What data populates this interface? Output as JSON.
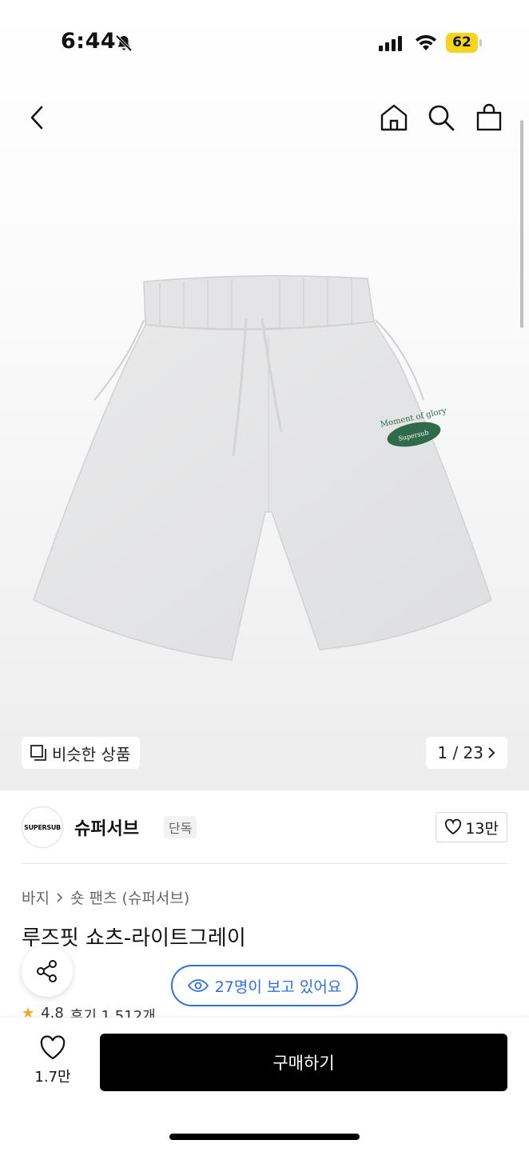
{
  "status_bar": {
    "time": "6:44",
    "battery": "62",
    "icons": [
      "bell-slash-icon",
      "signal-icon",
      "wifi-icon",
      "battery-icon"
    ]
  },
  "top_nav": {
    "icons": [
      "back-arrow-icon",
      "home-icon",
      "search-icon",
      "shopping-bag-icon"
    ]
  },
  "gallery": {
    "similar_label": "비슷한 상품",
    "counter": "1 / 23",
    "photo_text": [
      "Moment of glory",
      "Supersub"
    ]
  },
  "brand": {
    "logo_text": "SUPERSUB",
    "name": "슈퍼서브",
    "tag": "단독",
    "likes": "13만"
  },
  "product": {
    "breadcrumb": [
      "바지",
      "숏 팬츠 (슈퍼서브)"
    ],
    "title": "루즈핏 쇼츠-라이트그레이",
    "viewers": "27명이 보고 있어요",
    "rating": "4.8",
    "reviews": "후기 1,512개"
  },
  "bottom_bar": {
    "wish_count": "1.7만",
    "buy_label": "구매하기"
  },
  "colors": {
    "accent_blue": "#2f6fe4",
    "battery_yellow": "#f5d51c",
    "buy_black": "#000000",
    "star": "#f5a623"
  }
}
